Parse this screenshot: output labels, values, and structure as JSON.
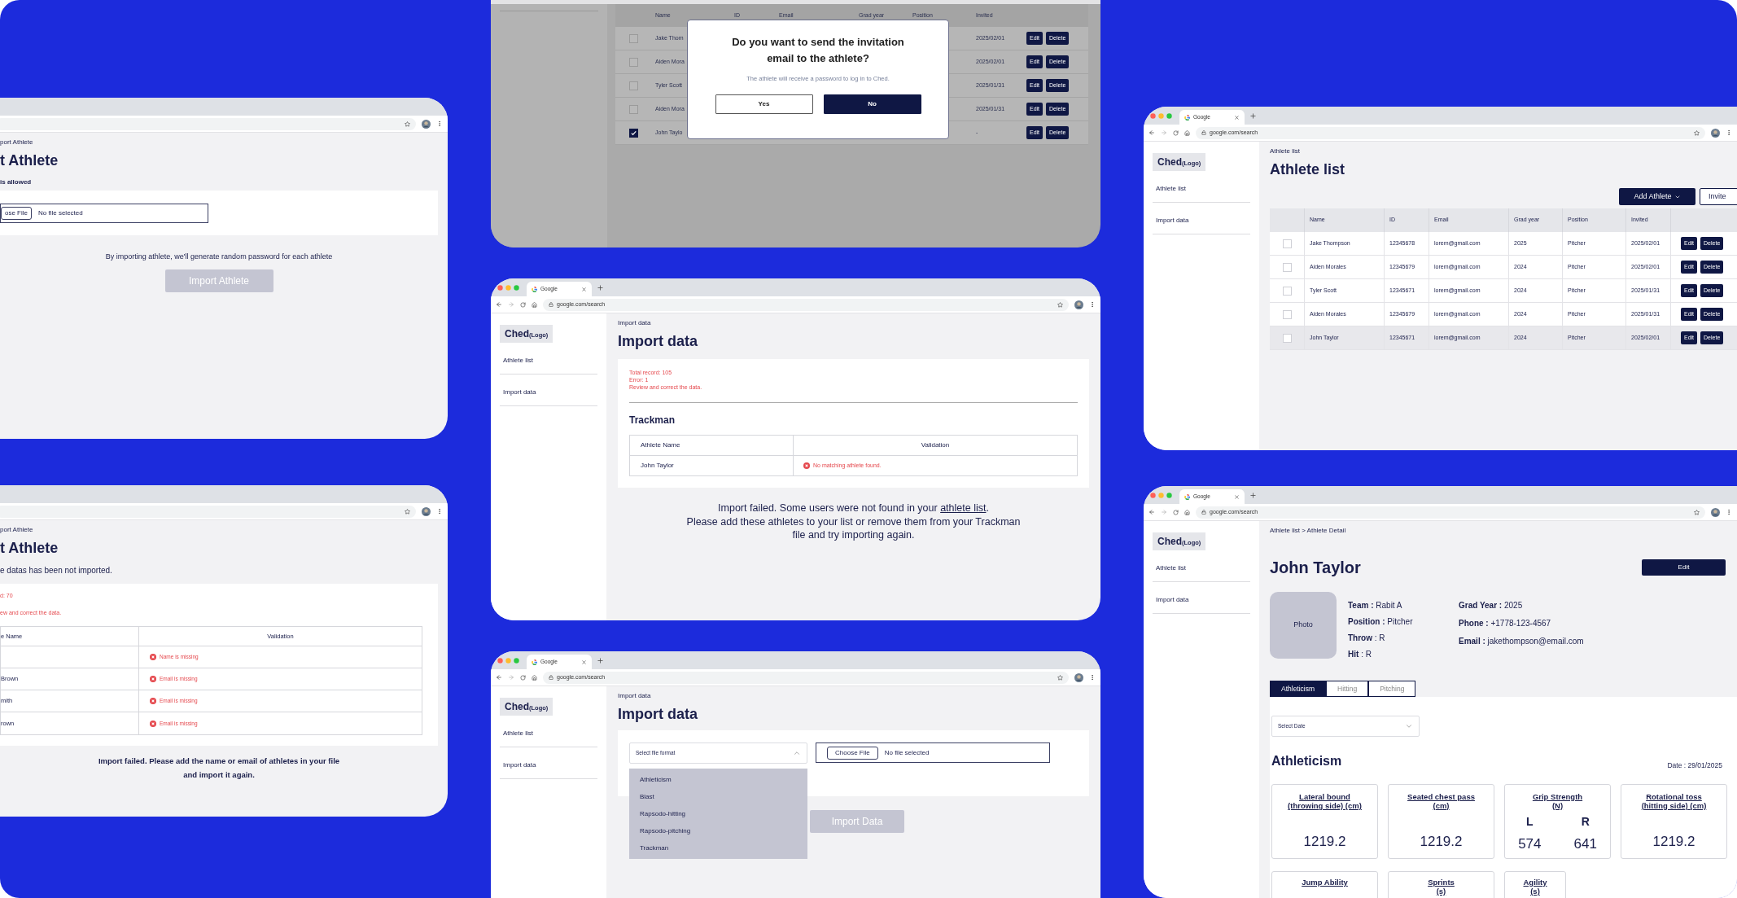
{
  "import_athlete_upload": {
    "breadcrumb": "port Athlete",
    "title": "t Athlete",
    "hint": "is allowed",
    "file_button": "ose File",
    "file_status": "No file selected",
    "note": "By importing athlete, we'll generate random password for each athlete",
    "import_button": {
      "label": "Import Athlete",
      "disabled": true
    }
  },
  "import_athlete_errors": {
    "breadcrumb": "port Athlete",
    "title": "t Athlete",
    "message": "e datas has been not imported.",
    "summary": [
      "d: 70",
      "ew and correct the data."
    ],
    "columns": [
      "e Name",
      "Validation"
    ],
    "rows": [
      {
        "error": "Name is missing"
      },
      {
        "name": "Brown",
        "error": "Email is missing"
      },
      {
        "name": "mith",
        "error": "Email is missing"
      },
      {
        "name": "rown",
        "error": "Email is missing"
      }
    ],
    "footer_lines": [
      "Import failed. Please add the name or email of athletes in your file",
      "and import it again."
    ]
  },
  "invite_dialog_screen": {
    "columns": [
      "Name",
      "ID",
      "Email",
      "Grad year",
      "Position",
      "Invited"
    ],
    "rows": [
      {
        "name": "Jake Thom",
        "invited": "2025/02/01",
        "checked": false,
        "actions": [
          "Edit",
          "Delete"
        ]
      },
      {
        "name": "Aiden Mora",
        "invited": "2025/02/01",
        "checked": false,
        "actions": [
          "Edit",
          "Delete"
        ]
      },
      {
        "name": "Tyler Scott",
        "invited": "2025/01/31",
        "checked": false,
        "actions": [
          "Edit",
          "Delete"
        ]
      },
      {
        "name": "Aiden Mora",
        "invited": "2025/01/31",
        "checked": false,
        "actions": [
          "Edit",
          "Delete"
        ]
      },
      {
        "name": "John Taylo",
        "invited": "-",
        "checked": true,
        "actions": [
          "Edit",
          "Delete"
        ]
      }
    ],
    "dialog": {
      "title_lines": [
        "Do you want to send the invitation",
        "email to the athlete?"
      ],
      "message": "The athlete will receive a password to log in to Ched.",
      "buttons": [
        {
          "label": "Yes",
          "kind": "secondary"
        },
        {
          "label": "No",
          "kind": "primary"
        }
      ]
    }
  },
  "import_error_screen": {
    "browser": {
      "tab": "Google",
      "url": "google.com/search"
    },
    "sidebar": {
      "logo": "Ched",
      "logo_note": "(Logo)",
      "items": [
        "Athlete list",
        "Import data"
      ]
    },
    "breadcrumb": "Import data",
    "title": "Import data",
    "summary": [
      "Total record: 105",
      "Error: 1",
      "Review and correct the data."
    ],
    "section": "Trackman",
    "columns": [
      "Athlete Name",
      "Validation"
    ],
    "rows": [
      {
        "name": "John Taylor",
        "error": "No matching athlete found."
      }
    ],
    "message": {
      "before": "Import failed. Some users were not found in your",
      "link": "athlete list",
      "after": ".",
      "lines": [
        "Please add these athletes to your list or remove them from your Trackman",
        "file and try importing again."
      ]
    }
  },
  "import_format_screen": {
    "browser": {
      "tab": "Google",
      "url": "google.com/search"
    },
    "sidebar": {
      "logo": "Ched",
      "logo_note": "(Logo)",
      "items": [
        "Athlete list",
        "Import data"
      ]
    },
    "breadcrumb": "Import data",
    "title": "Import data",
    "format_select": {
      "placeholder": "Select file format",
      "expanded": true,
      "options": [
        "Athleticism",
        "Blast",
        "Rapsodo-hitting",
        "Rapsodo-pitching",
        "Trackman"
      ]
    },
    "file_button": "Choose File",
    "file_status": "No file selected",
    "import_button": {
      "label": "Import Data",
      "disabled": true
    }
  },
  "athlete_list_screen": {
    "browser": {
      "tab": "Google",
      "url": "google.com/search"
    },
    "sidebar": {
      "logo": "Ched",
      "logo_note": "(Logo)",
      "items": [
        "Athlete list",
        "Import data"
      ]
    },
    "breadcrumb": "Athlete list",
    "title": "Athlete list",
    "add_button": "Add Athlete",
    "invite_button": "Invite",
    "columns": [
      "Name",
      "ID",
      "Email",
      "Grad year",
      "Position",
      "Invited"
    ],
    "rows": [
      {
        "name": "Jake Thompson",
        "id": "12345678",
        "email": "lorem@gmail.com",
        "grad_year": "2025",
        "position": "Pitcher",
        "invited": "2025/02/01",
        "checked": false,
        "selected": false,
        "actions": [
          "Edit",
          "Delete"
        ]
      },
      {
        "name": "Aiden Morales",
        "id": "12345679",
        "email": "lorem@gmail.com",
        "grad_year": "2024",
        "position": "Pitcher",
        "invited": "2025/02/01",
        "checked": false,
        "selected": false,
        "actions": [
          "Edit",
          "Delete"
        ]
      },
      {
        "name": "Tyler Scott",
        "id": "12345671",
        "email": "lorem@gmail.com",
        "grad_year": "2024",
        "position": "Pitcher",
        "invited": "2025/01/31",
        "checked": false,
        "selected": false,
        "actions": [
          "Edit",
          "Delete"
        ]
      },
      {
        "name": "Aiden Morales",
        "id": "12345679",
        "email": "lorem@gmail.com",
        "grad_year": "2024",
        "position": "Pitcher",
        "invited": "2025/01/31",
        "checked": false,
        "selected": false,
        "actions": [
          "Edit",
          "Delete"
        ]
      },
      {
        "name": "John Taylor",
        "id": "12345671",
        "email": "lorem@gmail.com",
        "grad_year": "2024",
        "position": "Pitcher",
        "invited": "2025/02/01",
        "checked": false,
        "selected": true,
        "actions": [
          "Edit",
          "Delete"
        ]
      }
    ]
  },
  "athlete_detail_screen": {
    "browser": {
      "tab": "Google",
      "url": "google.com/search"
    },
    "sidebar": {
      "logo": "Ched",
      "logo_note": "(Logo)",
      "items": [
        "Athlete list",
        "Import data"
      ]
    },
    "breadcrumb": "Athlete list > Athlete Detail",
    "name": "John Taylor",
    "edit_button": "Edit",
    "photo": "Photo",
    "info": [
      {
        "label": "Team :",
        "value": "Rabit A"
      },
      {
        "label": "Position :",
        "value": "Pitcher"
      },
      {
        "label": "Throw",
        "value": ": R"
      },
      {
        "label": "Hit",
        "value": ": R"
      }
    ],
    "contact": [
      {
        "label": "Grad Year :",
        "value": "2025"
      },
      {
        "label": "Phone :",
        "value": "+1778-123-4567"
      },
      {
        "label": "Email :",
        "value": "jakethompson@email.com"
      }
    ],
    "tabs": [
      {
        "label": "Athleticism",
        "selected": true
      },
      {
        "label": "Hitting",
        "selected": false
      },
      {
        "label": "Pitching",
        "selected": false
      }
    ],
    "date_select": {
      "placeholder": "Select Date"
    },
    "section": "Athleticism",
    "date": "Date : 29/01/2025",
    "metrics": [
      {
        "kind": "single",
        "title_lines": [
          "Lateral bound",
          "(throwing side) (cm)"
        ],
        "value": "1219.2"
      },
      {
        "kind": "single",
        "title_lines": [
          "Seated chest pass",
          "(cm)"
        ],
        "value": "1219.2"
      },
      {
        "kind": "split",
        "title_lines": [
          "Grip Strength",
          "(N)"
        ],
        "left_label": "L",
        "right_label": "R",
        "left_value": "574",
        "right_value": "641"
      },
      {
        "kind": "single",
        "title_lines": [
          "Rotational toss",
          "(hitting side) (cm)"
        ],
        "value": "1219.2"
      }
    ],
    "more_metrics": [
      {
        "title_lines": [
          "Jump Ability"
        ]
      },
      {
        "title_lines": [
          "Sprints",
          "(s)"
        ]
      },
      {
        "title_lines": [
          "Agility",
          "(s)"
        ]
      }
    ]
  }
}
